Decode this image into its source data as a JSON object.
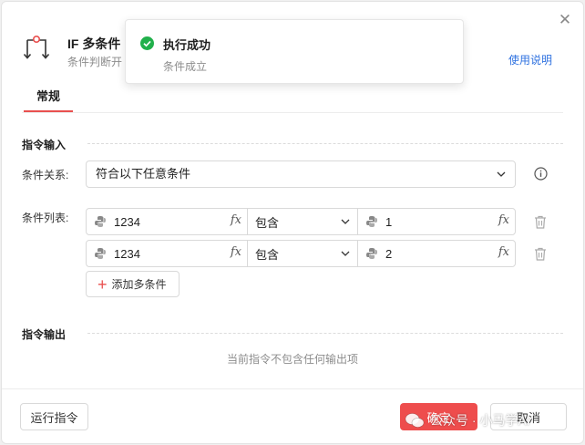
{
  "header": {
    "title": "IF 多条件",
    "subtitle": "条件判断开",
    "help_link": "使用说明",
    "close_icon": "close-icon",
    "command_icon": "if-branch-icon"
  },
  "tabs": [
    {
      "label": "常规",
      "active": true
    }
  ],
  "input_section": {
    "title": "指令输入",
    "condition_relation": {
      "label": "条件关系:",
      "value": "符合以下任意条件"
    },
    "condition_list": {
      "label": "条件列表:",
      "rows": [
        {
          "left": "1234",
          "operator": "包含",
          "right": "1"
        },
        {
          "left": "1234",
          "operator": "包含",
          "right": "2"
        }
      ],
      "fx_label": "fx",
      "add_button": "添加多条件"
    }
  },
  "output_section": {
    "title": "指令输出",
    "empty_text": "当前指令不包含任何输出项"
  },
  "footer": {
    "run_button": "运行指令",
    "ok_button": "确定",
    "cancel_button": "取消"
  },
  "toast": {
    "title": "执行成功",
    "message": "条件成立",
    "icon": "success-check-icon"
  },
  "watermark": {
    "text": "公众号 · 小马学AI",
    "icon": "wechat-icon"
  },
  "colors": {
    "accent": "#e9504f",
    "primary_button": "#ee4d4d",
    "link": "#2f72e0",
    "success": "#21b04b"
  }
}
